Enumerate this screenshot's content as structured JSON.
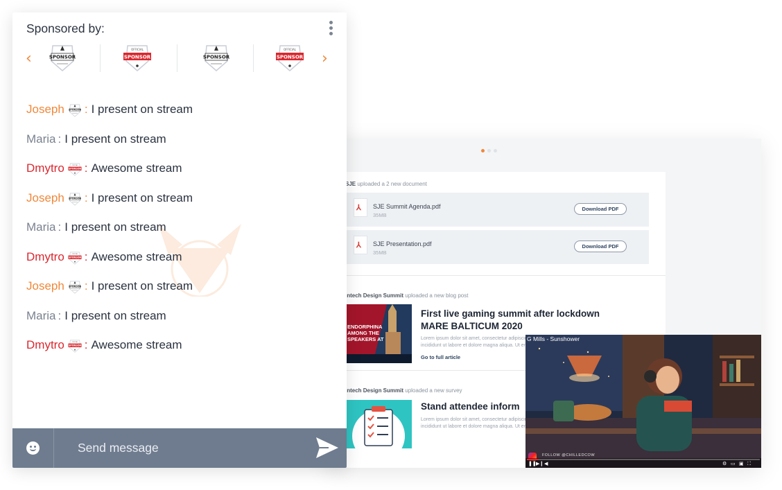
{
  "feed": {
    "doc_meta": {
      "author": "SJE",
      "action": "uploaded a 2 new document"
    },
    "documents": [
      {
        "name": "SJE Summit Agenda.pdf",
        "size": "35MB",
        "button": "Download PDF"
      },
      {
        "name": "SJE Presentation.pdf",
        "size": "35MB",
        "button": "Download PDF"
      }
    ],
    "blog_meta": {
      "author": "intech Design Summit",
      "action": "uploaded a new blog post"
    },
    "blog": {
      "title_line1": "First live gaming summit after lockdown",
      "title_line2": "MARE BALTICUM 2020",
      "body": "Lorem ipsum dolor sit amet, consectetur adipiscing elit, sed do eiusmod tempor incididunt ut labore et dolore magna aliqua. Ut enim ad minim veniam,",
      "link": "Go to full article",
      "thumb_text": "ENDORPHINA AMONG THE SPEAKERS AT"
    },
    "survey_meta": {
      "author": "intech Design Summit",
      "action": "uploaded a new survey"
    },
    "survey": {
      "title": "Stand attendee inform",
      "body": "Lorem ipsum dolor sit amet, consectetur adipiscing elit, sed do eiusmod tempor incididunt ut labore et dolore magna aliqua. Ut enim ad minim veniam,"
    },
    "pager": {
      "count": 3,
      "active": 0
    }
  },
  "video": {
    "title": "G Mills - Sunshower",
    "follow": "FOLLOW @CHILLEDCOW",
    "progress": 0.05
  },
  "chat": {
    "sponsored_label": "Sponsored by:",
    "sponsor_logos": [
      {
        "kind": "plain",
        "text": "SPONSOR"
      },
      {
        "kind": "official",
        "text": "SPONSOR"
      },
      {
        "kind": "plain",
        "text": "SPONSOR"
      },
      {
        "kind": "official",
        "text": "SPONSOR"
      }
    ],
    "messages": [
      {
        "user": "Joseph",
        "role": "joseph",
        "badge": "plain",
        "sep": ":",
        "text": "I present on stream"
      },
      {
        "user": "Maria",
        "role": "maria",
        "badge": "none",
        "sep": ":",
        "text": "I present on stream"
      },
      {
        "user": "Dmytro",
        "role": "dmytro",
        "badge": "official",
        "sep": ":",
        "text": "Awesome stream"
      },
      {
        "user": "Joseph",
        "role": "joseph",
        "badge": "plain",
        "sep": ":",
        "text": "I present on stream"
      },
      {
        "user": "Maria",
        "role": "maria",
        "badge": "none",
        "sep": ":",
        "text": "I present on stream"
      },
      {
        "user": "Dmytro",
        "role": "dmytro",
        "badge": "official",
        "sep": ":",
        "text": "Awesome stream"
      },
      {
        "user": "Joseph",
        "role": "joseph",
        "badge": "plain",
        "sep": ":",
        "text": "I present on stream"
      },
      {
        "user": "Maria",
        "role": "maria",
        "badge": "none",
        "sep": ":",
        "text": "I present on stream"
      },
      {
        "user": "Dmytro",
        "role": "dmytro",
        "badge": "official",
        "sep": ":",
        "text": "Awesome stream"
      }
    ],
    "composer": {
      "placeholder": "Send message"
    }
  },
  "colors": {
    "accent": "#f0883a",
    "joseph": "#f0883a",
    "maria": "#7a8290",
    "dmytro": "#d9282f",
    "composer_bg": "#6f7c8f",
    "sponsor_red": "#d9282f"
  },
  "icons": {
    "kebab": "more-vertical-icon",
    "prev": "chevron-left-icon",
    "next": "chevron-right-icon",
    "emoji": "smiley-icon",
    "send": "send-icon",
    "pdf": "pdf-icon"
  }
}
